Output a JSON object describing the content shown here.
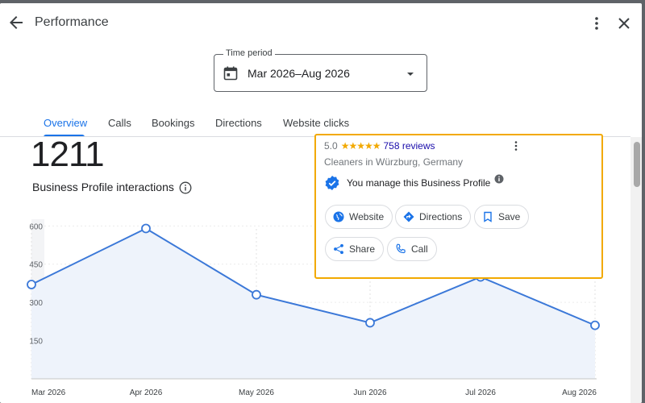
{
  "header": {
    "title": "Performance",
    "time_period": {
      "label": "Time period",
      "value": "Mar 2026–Aug 2026"
    },
    "tabs": [
      {
        "label": "Overview",
        "active": true
      },
      {
        "label": "Calls"
      },
      {
        "label": "Bookings"
      },
      {
        "label": "Directions"
      },
      {
        "label": "Website clicks"
      }
    ]
  },
  "overview": {
    "total": "1211",
    "metric_label": "Business Profile interactions"
  },
  "chart_data": {
    "type": "area",
    "x": [
      "Mar 2026",
      "Apr 2026",
      "May 2026",
      "Jun 2026",
      "Jul 2026",
      "Aug 2026"
    ],
    "y_ticks": [
      150,
      300,
      450,
      600
    ],
    "values": [
      370,
      590,
      330,
      220,
      400,
      210
    ],
    "ylim": [
      0,
      620
    ],
    "grid": true,
    "colors": {
      "line": "#3b78d8",
      "fill": "#eef3fb"
    }
  },
  "card": {
    "rating": "5.0",
    "stars": "★★★★★",
    "reviews": "758 reviews",
    "category": "Cleaners in Würzburg, Germany",
    "manage": "You manage this Business Profile",
    "actions": {
      "website": "Website",
      "directions": "Directions",
      "save": "Save",
      "share": "Share",
      "call": "Call"
    },
    "highlight_color": "#f2a900"
  },
  "colors": {
    "accent": "#1a73e8",
    "star": "#f2a900",
    "link": "#1a0dab"
  }
}
